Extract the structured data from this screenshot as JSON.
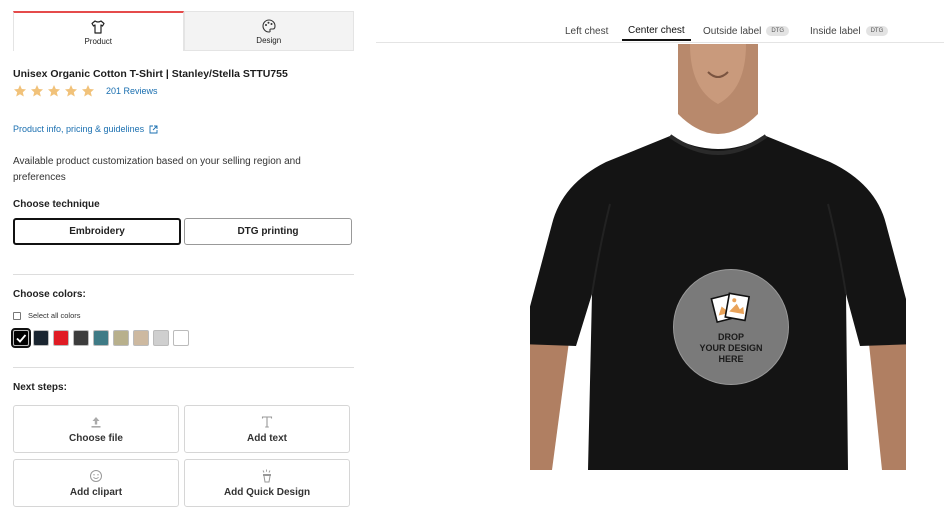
{
  "tabs": [
    {
      "label": "Product",
      "icon": "tshirt-icon",
      "active": true
    },
    {
      "label": "Design",
      "icon": "palette-icon",
      "active": false
    }
  ],
  "product": {
    "title": "Unisex Organic Cotton T-Shirt | Stanley/Stella STTU755",
    "rating": 5,
    "reviews": "201 Reviews",
    "info_link": "Product info, pricing & guidelines",
    "availability": "Available product customization based on your selling region and preferences"
  },
  "technique": {
    "heading": "Choose technique",
    "options": [
      "Embroidery",
      "DTG printing"
    ],
    "selected": "Embroidery"
  },
  "colors": {
    "heading": "Choose colors:",
    "select_all": "Select all colors",
    "swatches": [
      "#000000",
      "#1a2530",
      "#e01b24",
      "#3c3c3c",
      "#3f7b86",
      "#b8b08c",
      "#cdb9a0",
      "#cfcfcf",
      "#ffffff"
    ],
    "selected_index": 0
  },
  "next_steps": {
    "heading": "Next steps:",
    "items": [
      {
        "label": "Choose file",
        "icon": "upload-icon"
      },
      {
        "label": "Add text",
        "icon": "text-icon"
      },
      {
        "label": "Add clipart",
        "icon": "smiley-icon"
      },
      {
        "label": "Add Quick Design",
        "icon": "magic-wand-icon"
      }
    ]
  },
  "placement_tabs": [
    {
      "label": "Left chest",
      "badge": ""
    },
    {
      "label": "Center chest",
      "badge": "",
      "active": true
    },
    {
      "label": "Outside label",
      "badge": "DTG"
    },
    {
      "label": "Inside label",
      "badge": "DTG"
    }
  ],
  "drop_zone": {
    "line1": "DROP",
    "line2": "YOUR DESIGN",
    "line3": "HERE"
  },
  "accent": "#e54b4b",
  "link_color": "#1a6fb0",
  "star_color": "#f1c27a"
}
